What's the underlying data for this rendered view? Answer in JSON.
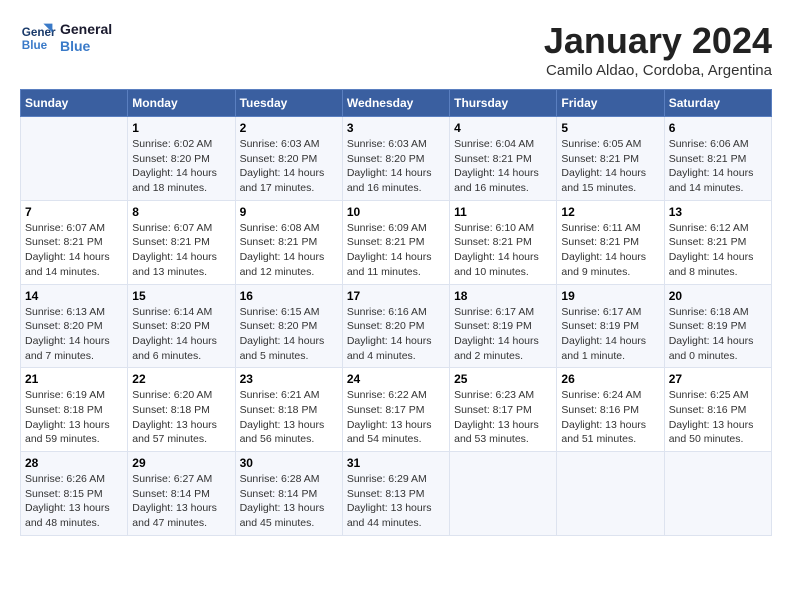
{
  "logo": {
    "line1": "General",
    "line2": "Blue"
  },
  "title": "January 2024",
  "subtitle": "Camilo Aldao, Cordoba, Argentina",
  "weekdays": [
    "Sunday",
    "Monday",
    "Tuesday",
    "Wednesday",
    "Thursday",
    "Friday",
    "Saturday"
  ],
  "weeks": [
    [
      {
        "day": "",
        "info": ""
      },
      {
        "day": "1",
        "info": "Sunrise: 6:02 AM\nSunset: 8:20 PM\nDaylight: 14 hours\nand 18 minutes."
      },
      {
        "day": "2",
        "info": "Sunrise: 6:03 AM\nSunset: 8:20 PM\nDaylight: 14 hours\nand 17 minutes."
      },
      {
        "day": "3",
        "info": "Sunrise: 6:03 AM\nSunset: 8:20 PM\nDaylight: 14 hours\nand 16 minutes."
      },
      {
        "day": "4",
        "info": "Sunrise: 6:04 AM\nSunset: 8:21 PM\nDaylight: 14 hours\nand 16 minutes."
      },
      {
        "day": "5",
        "info": "Sunrise: 6:05 AM\nSunset: 8:21 PM\nDaylight: 14 hours\nand 15 minutes."
      },
      {
        "day": "6",
        "info": "Sunrise: 6:06 AM\nSunset: 8:21 PM\nDaylight: 14 hours\nand 14 minutes."
      }
    ],
    [
      {
        "day": "7",
        "info": "Sunrise: 6:07 AM\nSunset: 8:21 PM\nDaylight: 14 hours\nand 14 minutes."
      },
      {
        "day": "8",
        "info": "Sunrise: 6:07 AM\nSunset: 8:21 PM\nDaylight: 14 hours\nand 13 minutes."
      },
      {
        "day": "9",
        "info": "Sunrise: 6:08 AM\nSunset: 8:21 PM\nDaylight: 14 hours\nand 12 minutes."
      },
      {
        "day": "10",
        "info": "Sunrise: 6:09 AM\nSunset: 8:21 PM\nDaylight: 14 hours\nand 11 minutes."
      },
      {
        "day": "11",
        "info": "Sunrise: 6:10 AM\nSunset: 8:21 PM\nDaylight: 14 hours\nand 10 minutes."
      },
      {
        "day": "12",
        "info": "Sunrise: 6:11 AM\nSunset: 8:21 PM\nDaylight: 14 hours\nand 9 minutes."
      },
      {
        "day": "13",
        "info": "Sunrise: 6:12 AM\nSunset: 8:21 PM\nDaylight: 14 hours\nand 8 minutes."
      }
    ],
    [
      {
        "day": "14",
        "info": "Sunrise: 6:13 AM\nSunset: 8:20 PM\nDaylight: 14 hours\nand 7 minutes."
      },
      {
        "day": "15",
        "info": "Sunrise: 6:14 AM\nSunset: 8:20 PM\nDaylight: 14 hours\nand 6 minutes."
      },
      {
        "day": "16",
        "info": "Sunrise: 6:15 AM\nSunset: 8:20 PM\nDaylight: 14 hours\nand 5 minutes."
      },
      {
        "day": "17",
        "info": "Sunrise: 6:16 AM\nSunset: 8:20 PM\nDaylight: 14 hours\nand 4 minutes."
      },
      {
        "day": "18",
        "info": "Sunrise: 6:17 AM\nSunset: 8:19 PM\nDaylight: 14 hours\nand 2 minutes."
      },
      {
        "day": "19",
        "info": "Sunrise: 6:17 AM\nSunset: 8:19 PM\nDaylight: 14 hours\nand 1 minute."
      },
      {
        "day": "20",
        "info": "Sunrise: 6:18 AM\nSunset: 8:19 PM\nDaylight: 14 hours\nand 0 minutes."
      }
    ],
    [
      {
        "day": "21",
        "info": "Sunrise: 6:19 AM\nSunset: 8:18 PM\nDaylight: 13 hours\nand 59 minutes."
      },
      {
        "day": "22",
        "info": "Sunrise: 6:20 AM\nSunset: 8:18 PM\nDaylight: 13 hours\nand 57 minutes."
      },
      {
        "day": "23",
        "info": "Sunrise: 6:21 AM\nSunset: 8:18 PM\nDaylight: 13 hours\nand 56 minutes."
      },
      {
        "day": "24",
        "info": "Sunrise: 6:22 AM\nSunset: 8:17 PM\nDaylight: 13 hours\nand 54 minutes."
      },
      {
        "day": "25",
        "info": "Sunrise: 6:23 AM\nSunset: 8:17 PM\nDaylight: 13 hours\nand 53 minutes."
      },
      {
        "day": "26",
        "info": "Sunrise: 6:24 AM\nSunset: 8:16 PM\nDaylight: 13 hours\nand 51 minutes."
      },
      {
        "day": "27",
        "info": "Sunrise: 6:25 AM\nSunset: 8:16 PM\nDaylight: 13 hours\nand 50 minutes."
      }
    ],
    [
      {
        "day": "28",
        "info": "Sunrise: 6:26 AM\nSunset: 8:15 PM\nDaylight: 13 hours\nand 48 minutes."
      },
      {
        "day": "29",
        "info": "Sunrise: 6:27 AM\nSunset: 8:14 PM\nDaylight: 13 hours\nand 47 minutes."
      },
      {
        "day": "30",
        "info": "Sunrise: 6:28 AM\nSunset: 8:14 PM\nDaylight: 13 hours\nand 45 minutes."
      },
      {
        "day": "31",
        "info": "Sunrise: 6:29 AM\nSunset: 8:13 PM\nDaylight: 13 hours\nand 44 minutes."
      },
      {
        "day": "",
        "info": ""
      },
      {
        "day": "",
        "info": ""
      },
      {
        "day": "",
        "info": ""
      }
    ]
  ]
}
